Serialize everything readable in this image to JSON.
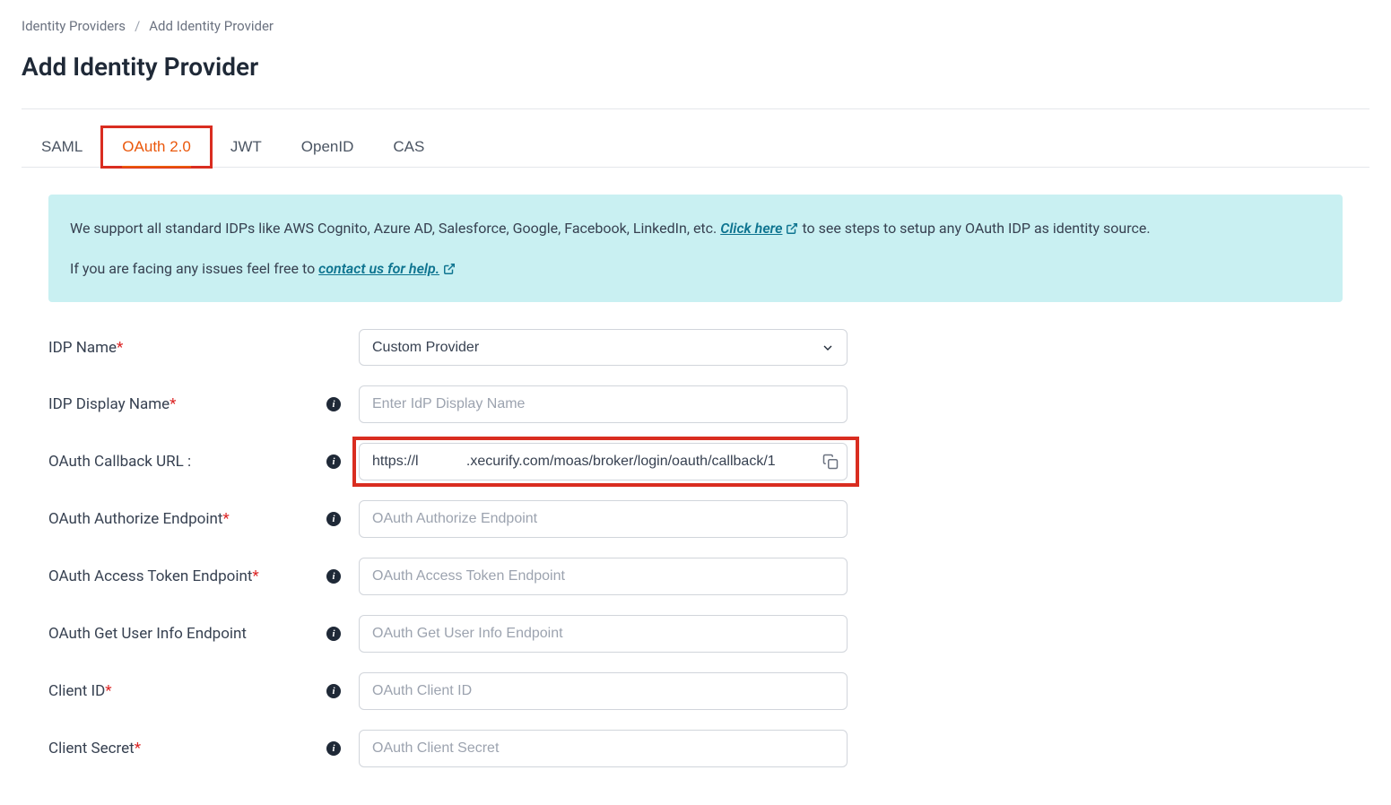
{
  "breadcrumb": {
    "parent": "Identity Providers",
    "separator": "/",
    "current": "Add Identity Provider"
  },
  "page": {
    "title": "Add Identity Provider"
  },
  "tabs": [
    {
      "label": "SAML",
      "active": false
    },
    {
      "label": "OAuth 2.0",
      "active": true
    },
    {
      "label": "JWT",
      "active": false
    },
    {
      "label": "OpenID",
      "active": false
    },
    {
      "label": "CAS",
      "active": false
    }
  ],
  "info": {
    "line1_pre": "We support all standard IDPs like AWS Cognito, Azure AD, Salesforce, Google, Facebook, LinkedIn, etc. ",
    "link1": "Click here",
    "line1_post": " to see steps to setup any OAuth IDP as identity source.",
    "line2_pre": "If you are facing any issues feel free to ",
    "link2": "contact us for help."
  },
  "form": {
    "idp_name": {
      "label": "IDP Name",
      "required": true,
      "value": "Custom Provider"
    },
    "idp_display_name": {
      "label": "IDP Display Name",
      "required": true,
      "placeholder": "Enter IdP Display Name",
      "value": ""
    },
    "callback_url": {
      "label": "OAuth Callback URL :",
      "required": false,
      "value": "https://l            .xecurify.com/moas/broker/login/oauth/callback/1"
    },
    "authorize_endpoint": {
      "label": "OAuth Authorize Endpoint",
      "required": true,
      "placeholder": "OAuth Authorize Endpoint",
      "value": ""
    },
    "token_endpoint": {
      "label": "OAuth Access Token Endpoint",
      "required": true,
      "placeholder": "OAuth Access Token Endpoint",
      "value": ""
    },
    "userinfo_endpoint": {
      "label": "OAuth Get User Info Endpoint",
      "required": false,
      "placeholder": "OAuth Get User Info Endpoint",
      "value": ""
    },
    "client_id": {
      "label": "Client ID",
      "required": true,
      "placeholder": "OAuth Client ID",
      "value": ""
    },
    "client_secret": {
      "label": "Client Secret",
      "required": true,
      "placeholder": "OAuth Client Secret",
      "value": ""
    }
  }
}
